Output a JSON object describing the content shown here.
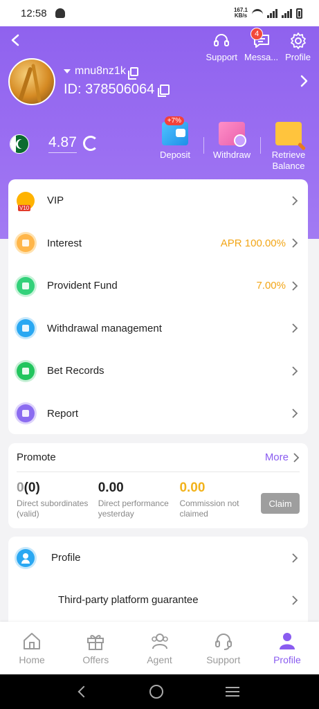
{
  "status_bar": {
    "time": "12:58",
    "net_speed": "167.1",
    "net_unit": "KB/s"
  },
  "header": {
    "support_label": "Support",
    "messages_label": "Messa...",
    "messages_badge": "4",
    "profile_label": "Profile",
    "username": "mnu8nz1k",
    "id_text": "ID: 378506064",
    "balance": "4.87"
  },
  "actions": {
    "deposit_label": "Deposit",
    "deposit_bonus": "+7%",
    "withdraw_label": "Withdraw",
    "retrieve_label": "Retrieve Balance"
  },
  "menu": [
    {
      "label": "VIP",
      "value": ""
    },
    {
      "label": "Interest",
      "value": "APR 100.00%"
    },
    {
      "label": "Provident Fund",
      "value": "7.00%"
    },
    {
      "label": "Withdrawal management",
      "value": ""
    },
    {
      "label": "Bet Records",
      "value": ""
    },
    {
      "label": "Report",
      "value": ""
    }
  ],
  "promote": {
    "title": "Promote",
    "more_label": "More",
    "subordinates_main": "0",
    "subordinates_paren": "(0)",
    "subordinates_desc": "Direct subordinates (valid)",
    "performance_value": "0.00",
    "performance_desc": "Direct performance yesterday",
    "commission_value": "0.00",
    "commission_desc": "Commission not claimed",
    "claim_label": "Claim"
  },
  "profile_section": {
    "profile_label": "Profile",
    "guarantee_label": "Third-party platform guarantee"
  },
  "bottom_nav": [
    {
      "label": "Home",
      "icon": "home-icon"
    },
    {
      "label": "Offers",
      "icon": "gift-icon"
    },
    {
      "label": "Agent",
      "icon": "agent-icon"
    },
    {
      "label": "Support",
      "icon": "headset-icon"
    },
    {
      "label": "Profile",
      "icon": "person-icon"
    }
  ],
  "colors": {
    "accent": "#8a5cf0",
    "header": "#9b6ff2",
    "gold": "#f2a516"
  }
}
